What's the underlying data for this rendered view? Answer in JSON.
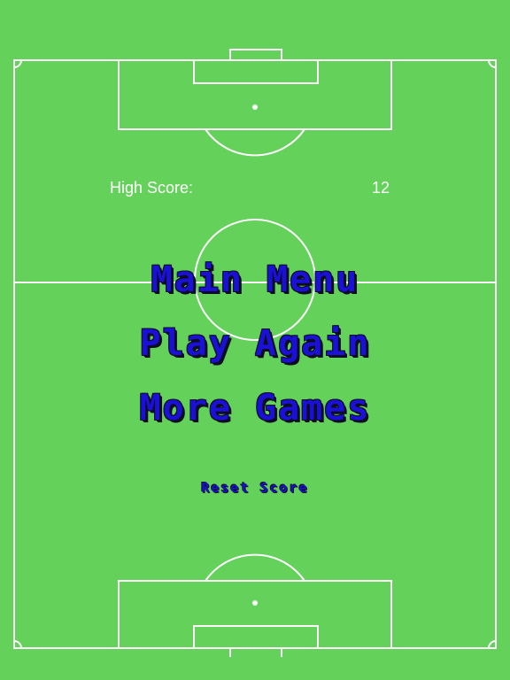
{
  "high_score": {
    "label": "High Score:",
    "value": "12"
  },
  "menu": {
    "main_menu": "Main Menu",
    "play_again": "Play Again",
    "more_games": "More Games",
    "reset_score": "Reset Score"
  },
  "colors": {
    "field": "#63d15a",
    "lines": "#ffffff",
    "button_text": "#1a10d6",
    "button_outline": "#0c0c22"
  }
}
